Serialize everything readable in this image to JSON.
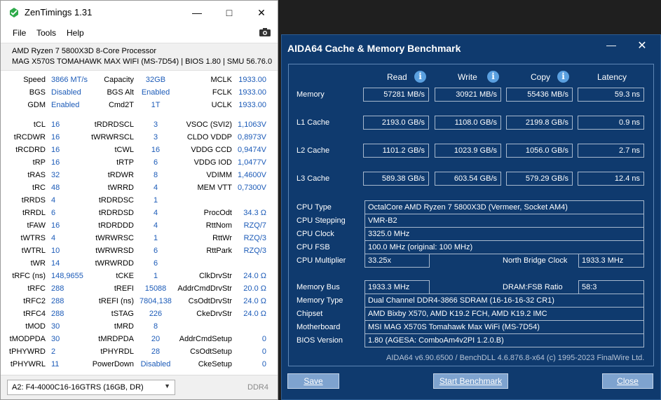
{
  "zentimings": {
    "title": "ZenTimings 1.31",
    "menu": [
      "File",
      "Tools",
      "Help"
    ],
    "cpu": "AMD Ryzen 7 5800X3D 8-Core Processor",
    "board": "MAG X570S TOMAHAWK MAX WIFI (MS-7D54) | BIOS 1.80 | SMU 56.76.0",
    "rows": [
      [
        "Speed",
        "3866 MT/s",
        "Capacity",
        "32GB",
        "MCLK",
        "1933.00"
      ],
      [
        "BGS",
        "Disabled",
        "BGS Alt",
        "Enabled",
        "FCLK",
        "1933.00"
      ],
      [
        "GDM",
        "Enabled",
        "Cmd2T",
        "1T",
        "UCLK",
        "1933.00"
      ],
      [
        "tCL",
        "16",
        "tRDRDSCL",
        "3",
        "VSOC (SVI2)",
        "1,1063V"
      ],
      [
        "tRCDWR",
        "16",
        "tWRWRSCL",
        "3",
        "CLDO VDDP",
        "0,8973V"
      ],
      [
        "tRCDRD",
        "16",
        "tCWL",
        "16",
        "VDDG CCD",
        "0,9474V"
      ],
      [
        "tRP",
        "16",
        "tRTP",
        "6",
        "VDDG IOD",
        "1,0477V"
      ],
      [
        "tRAS",
        "32",
        "tRDWR",
        "8",
        "VDIMM",
        "1,4600V"
      ],
      [
        "tRC",
        "48",
        "tWRRD",
        "4",
        "MEM VTT",
        "0,7300V"
      ],
      [
        "tRRDS",
        "4",
        "tRDRDSC",
        "1",
        "",
        ""
      ],
      [
        "tRRDL",
        "6",
        "tRDRDSD",
        "4",
        "ProcOdt",
        "34.3 Ω"
      ],
      [
        "tFAW",
        "16",
        "tRDRDDD",
        "4",
        "RttNom",
        "RZQ/7"
      ],
      [
        "tWTRS",
        "4",
        "tWRWRSC",
        "1",
        "RttWr",
        "RZQ/3"
      ],
      [
        "tWTRL",
        "10",
        "tWRWRSD",
        "6",
        "RttPark",
        "RZQ/3"
      ],
      [
        "tWR",
        "14",
        "tWRWRDD",
        "6",
        "",
        ""
      ],
      [
        "tRFC (ns)",
        "148,9655",
        "tCKE",
        "1",
        "ClkDrvStr",
        "24.0 Ω"
      ],
      [
        "tRFC",
        "288",
        "tREFI",
        "15088",
        "AddrCmdDrvStr",
        "20.0 Ω"
      ],
      [
        "tRFC2",
        "288",
        "tREFI (ns)",
        "7804,138",
        "CsOdtDrvStr",
        "24.0 Ω"
      ],
      [
        "tRFC4",
        "288",
        "tSTAG",
        "226",
        "CkeDrvStr",
        "24.0 Ω"
      ],
      [
        "tMOD",
        "30",
        "tMRD",
        "8",
        "",
        ""
      ],
      [
        "tMODPDA",
        "30",
        "tMRDPDA",
        "20",
        "AddrCmdSetup",
        "0"
      ],
      [
        "tPHYWRD",
        "2",
        "tPHYRDL",
        "28",
        "CsOdtSetup",
        "0"
      ],
      [
        "tPHYWRL",
        "11",
        "PowerDown",
        "Disabled",
        "CkeSetup",
        "0"
      ]
    ],
    "module": "A2: F4-4000C16-16GTRS (16GB, DR)",
    "ddr": "DDR4"
  },
  "aida": {
    "title": "AIDA64 Cache & Memory Benchmark",
    "headers": [
      "Read",
      "Write",
      "Copy",
      "Latency"
    ],
    "bench": [
      {
        "label": "Memory",
        "read": "57281 MB/s",
        "write": "30921 MB/s",
        "copy": "55436 MB/s",
        "latency": "59.3 ns"
      },
      {
        "label": "L1 Cache",
        "read": "2193.0 GB/s",
        "write": "1108.0 GB/s",
        "copy": "2199.8 GB/s",
        "latency": "0.9 ns"
      },
      {
        "label": "L2 Cache",
        "read": "1101.2 GB/s",
        "write": "1023.9 GB/s",
        "copy": "1056.0 GB/s",
        "latency": "2.7 ns"
      },
      {
        "label": "L3 Cache",
        "read": "589.38 GB/s",
        "write": "603.54 GB/s",
        "copy": "579.29 GB/s",
        "latency": "12.4 ns"
      }
    ],
    "cpu_type_label": "CPU Type",
    "cpu_type": "OctalCore AMD Ryzen 7 5800X3D  (Vermeer, Socket AM4)",
    "cpu_stepping_label": "CPU Stepping",
    "cpu_stepping": "VMR-B2",
    "cpu_clock_label": "CPU Clock",
    "cpu_clock": "3325.0 MHz",
    "cpu_fsb_label": "CPU FSB",
    "cpu_fsb": "100.0 MHz  (original: 100 MHz)",
    "cpu_mult_label": "CPU Multiplier",
    "cpu_mult": "33.25x",
    "nb_clock_label": "North Bridge Clock",
    "nb_clock": "1933.3 MHz",
    "mem_bus_label": "Memory Bus",
    "mem_bus": "1933.3 MHz",
    "dram_fsb_label": "DRAM:FSB Ratio",
    "dram_fsb": "58:3",
    "mem_type_label": "Memory Type",
    "mem_type": "Dual Channel DDR4-3866 SDRAM  (16-16-16-32 CR1)",
    "chipset_label": "Chipset",
    "chipset": "AMD Bixby X570, AMD K19.2 FCH, AMD K19.2 IMC",
    "mobo_label": "Motherboard",
    "mobo": "MSI MAG X570S Tomahawk Max WiFi (MS-7D54)",
    "bios_label": "BIOS Version",
    "bios": "1.80  (AGESA: ComboAm4v2PI 1.2.0.B)",
    "footer": "AIDA64 v6.90.6500 / BenchDLL 4.6.876.8-x64  (c) 1995-2023 FinalWire Ltd.",
    "save": "Save",
    "start": "Start Benchmark",
    "close": "Close"
  }
}
